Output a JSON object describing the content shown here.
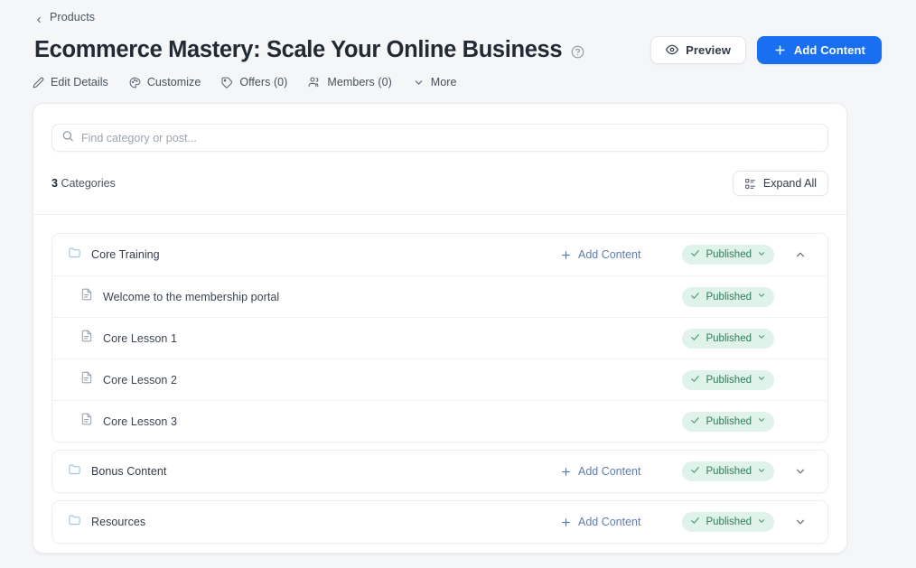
{
  "breadcrumb": {
    "label": "Products",
    "icon": "chevron-left-icon"
  },
  "header": {
    "title": "Ecommerce Mastery: Scale Your Online Business",
    "help_icon": "help-circle-icon",
    "preview_label": "Preview",
    "preview_icon": "eye-icon",
    "add_content_label": "Add Content",
    "add_content_icon": "plus-icon",
    "primary_color": "#1a6ff0"
  },
  "subnav": [
    {
      "label": "Edit Details",
      "icon": "pencil-icon"
    },
    {
      "label": "Customize",
      "icon": "palette-icon"
    },
    {
      "label": "Offers (0)",
      "icon": "tag-icon"
    },
    {
      "label": "Members (0)",
      "icon": "users-icon"
    },
    {
      "label": "More",
      "icon": "chevron-down-icon"
    }
  ],
  "search": {
    "placeholder": "Find category or post...",
    "value": "",
    "icon": "search-icon"
  },
  "meta": {
    "count": "3",
    "count_label": "Categories",
    "expand_all_label": "Expand All",
    "expand_all_icon": "expand-list-icon"
  },
  "link_labels": {
    "add_content": "Add Content",
    "add_content_icon": "plus-icon",
    "link_color": "#5d7cb4"
  },
  "status": {
    "published_label": "Published",
    "check_icon": "check-icon",
    "caret_icon": "chevron-down-icon",
    "badge_bg": "#dff3ea",
    "badge_fg": "#2f7a5f"
  },
  "categories": [
    {
      "name": "Core Training",
      "icon": "folder-icon",
      "status": "Published",
      "expanded": true,
      "toggle_icon": "chevron-up-icon",
      "has_add_content": true,
      "items": [
        {
          "name": "Welcome to the membership portal",
          "icon": "document-icon",
          "status": "Published"
        },
        {
          "name": "Core Lesson 1",
          "icon": "document-icon",
          "status": "Published"
        },
        {
          "name": "Core Lesson 2",
          "icon": "document-icon",
          "status": "Published"
        },
        {
          "name": "Core Lesson 3",
          "icon": "document-icon",
          "status": "Published"
        }
      ]
    },
    {
      "name": "Bonus Content",
      "icon": "folder-icon",
      "status": "Published",
      "expanded": false,
      "toggle_icon": "chevron-down-icon",
      "has_add_content": true,
      "items": []
    },
    {
      "name": "Resources",
      "icon": "folder-icon",
      "status": "Published",
      "expanded": false,
      "toggle_icon": "chevron-down-icon",
      "has_add_content": true,
      "items": []
    }
  ]
}
